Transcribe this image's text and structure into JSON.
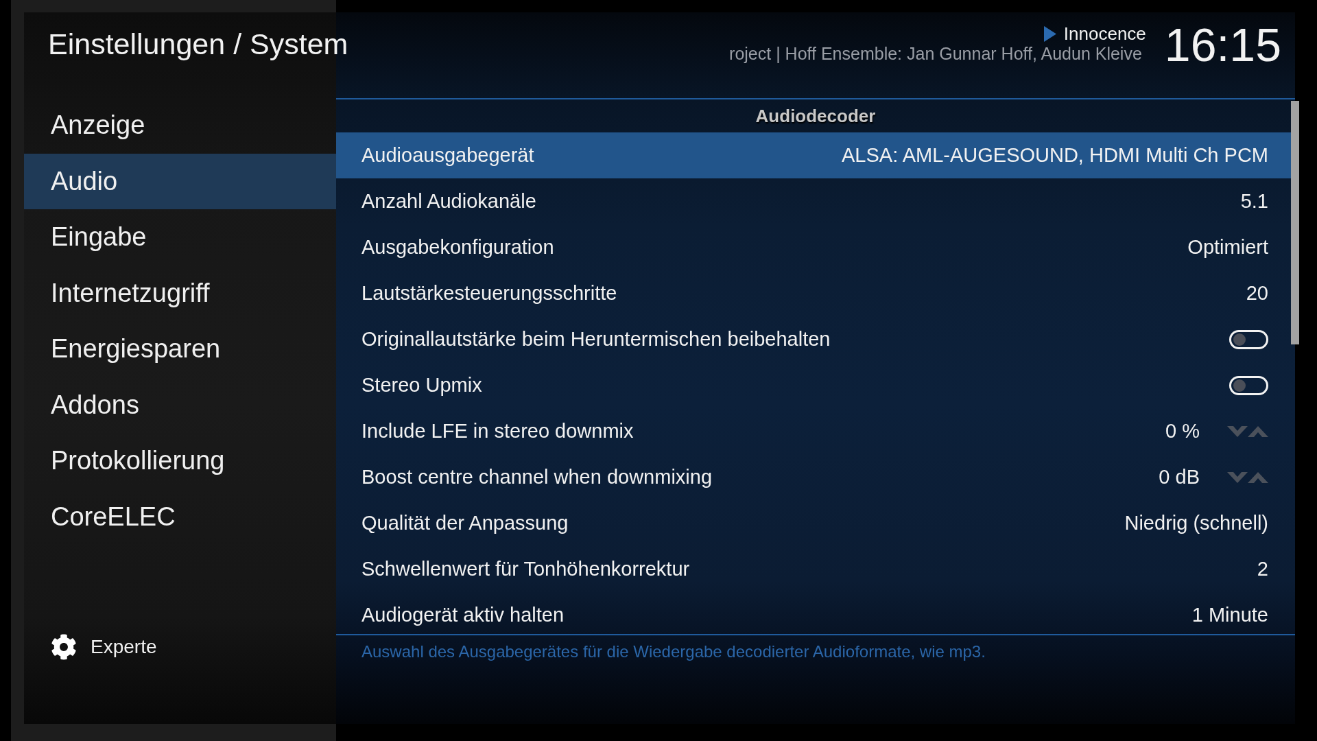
{
  "header": {
    "title": "Einstellungen / System"
  },
  "sidebar": {
    "items": [
      {
        "label": "Anzeige",
        "selected": false
      },
      {
        "label": "Audio",
        "selected": true
      },
      {
        "label": "Eingabe",
        "selected": false
      },
      {
        "label": "Internetzugriff",
        "selected": false
      },
      {
        "label": "Energiesparen",
        "selected": false
      },
      {
        "label": "Addons",
        "selected": false
      },
      {
        "label": "Protokollierung",
        "selected": false
      },
      {
        "label": "CoreELEC",
        "selected": false
      }
    ],
    "level_button": {
      "label": "Experte"
    }
  },
  "now_playing": {
    "title": "Innocence",
    "subtitle": "roject | Hoff Ensemble: Jan Gunnar Hoff, Audun Kleive"
  },
  "clock": "16:15",
  "settings": {
    "section_title": "Audiodecoder",
    "rows": [
      {
        "kind": "value",
        "label": "Audioausgabegerät",
        "value": "ALSA: AML-AUGESOUND, HDMI Multi Ch PCM",
        "selected": true
      },
      {
        "kind": "value",
        "label": "Anzahl Audiokanäle",
        "value": "5.1",
        "selected": false
      },
      {
        "kind": "value",
        "label": "Ausgabekonfiguration",
        "value": "Optimiert",
        "selected": false
      },
      {
        "kind": "value",
        "label": "Lautstärkesteuerungsschritte",
        "value": "20",
        "selected": false
      },
      {
        "kind": "toggle",
        "label": "Originallautstärke beim Heruntermischen beibehalten",
        "on": false,
        "selected": false
      },
      {
        "kind": "toggle",
        "label": "Stereo Upmix",
        "on": false,
        "selected": false
      },
      {
        "kind": "spinner",
        "label": "Include LFE in stereo downmix",
        "value": "0 %",
        "selected": false
      },
      {
        "kind": "spinner",
        "label": "Boost centre channel when downmixing",
        "value": "0 dB",
        "selected": false
      },
      {
        "kind": "value",
        "label": "Qualität der Anpassung",
        "value": "Niedrig (schnell)",
        "selected": false
      },
      {
        "kind": "value",
        "label": "Schwellenwert für Tonhöhenkorrektur",
        "value": "2",
        "selected": false
      },
      {
        "kind": "value",
        "label": "Audiogerät aktiv halten",
        "value": "1 Minute",
        "selected": false
      }
    ],
    "description": "Auswahl des Ausgabegerätes für die Wiedergabe decodierter Audioformate, wie mp3."
  }
}
